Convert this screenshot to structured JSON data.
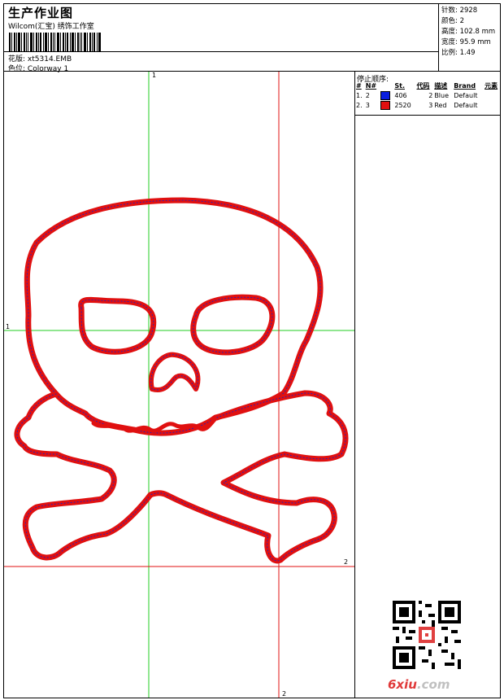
{
  "header": {
    "title": "生产作业图",
    "subtitle": "Wilcom(汇宝) 绣饰工作室",
    "design_label": "花版:",
    "design_value": "xt5314.EMB",
    "colorway_label": "色位:",
    "colorway_value": "Colorway 1"
  },
  "stats": {
    "stitches_label": "针数:",
    "stitches_value": "2928",
    "colors_label": "颜色:",
    "colors_value": "2",
    "height_label": "高度:",
    "height_value": "102.8 mm",
    "width_label": "宽度:",
    "width_value": "95.9 mm",
    "scale_label": "比例:",
    "scale_value": "1.49"
  },
  "stop_sequence": {
    "title": "停止顺序:",
    "columns": [
      "#",
      "N#",
      "St.",
      "代码",
      "描述",
      "Brand",
      "元素"
    ],
    "rows": [
      {
        "index": "1.",
        "n": "2",
        "color": "#0a1ee0",
        "st": "406",
        "code": "2",
        "desc": "Blue",
        "brand": "Default",
        "element": ""
      },
      {
        "index": "2.",
        "n": "3",
        "color": "#e01010",
        "st": "2520",
        "code": "3",
        "desc": "Red",
        "brand": "Default",
        "element": ""
      }
    ]
  },
  "guides": {
    "top_label": "1",
    "left_label": "1",
    "right_label": "2",
    "bottom_label": "2"
  },
  "colors": {
    "green_guide": "#22cc22",
    "red_guide": "#e01010",
    "stitch_red": "#e01010",
    "stitch_blue": "#2020c0"
  },
  "watermark": {
    "text_main": "6xiu",
    "text_dot": ".com"
  }
}
